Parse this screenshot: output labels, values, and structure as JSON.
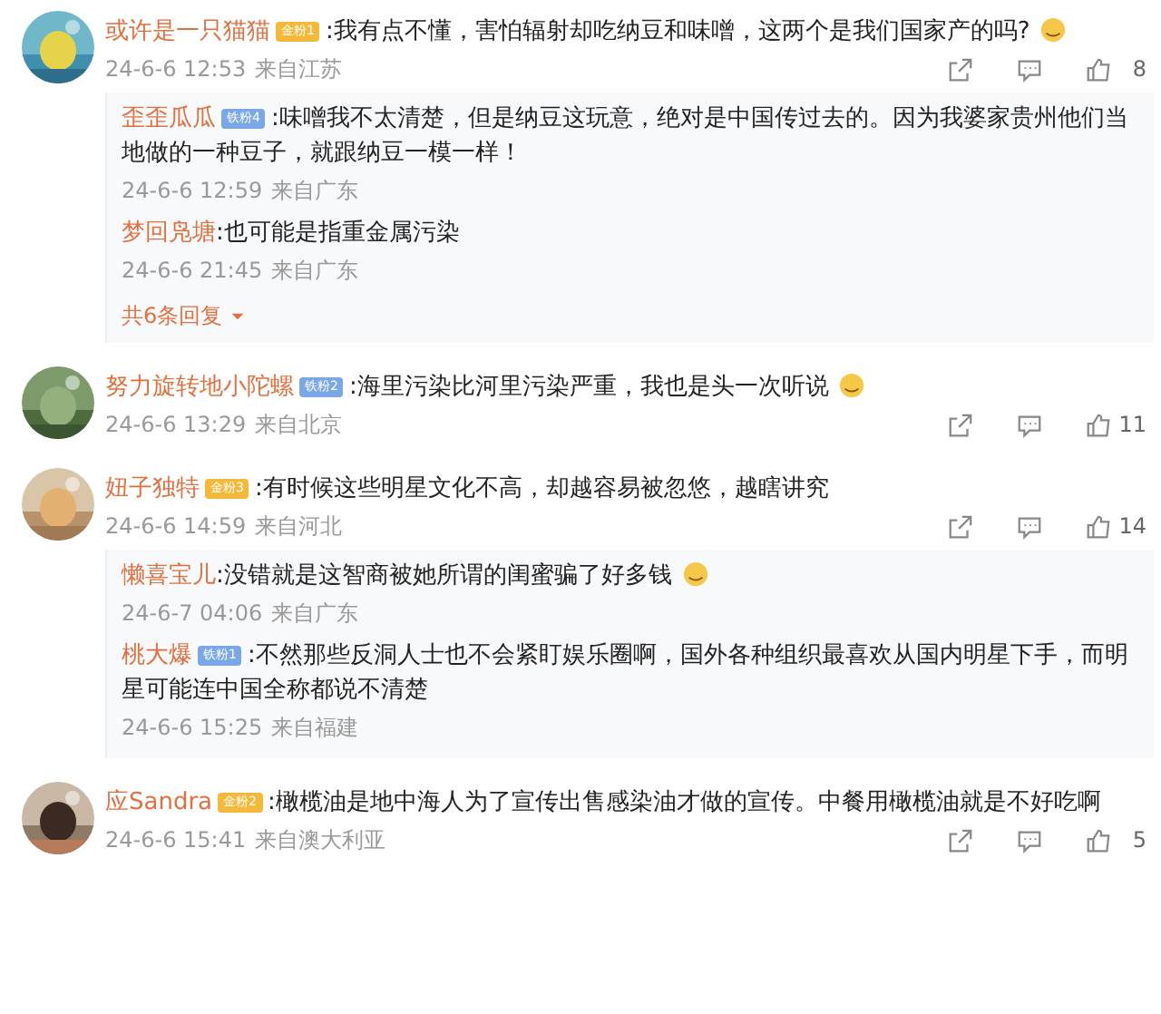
{
  "comments": [
    {
      "name": "或许是一只猫猫",
      "badge": {
        "kind": "gold",
        "label": "金粉1"
      },
      "text": ":我有点不懂，害怕辐射却吃纳豆和味噌，这两个是我们国家产的吗?",
      "emoji": true,
      "time": "24-6-6 12:53",
      "location": "来自江苏",
      "likes": "8",
      "replies": [
        {
          "name": "歪歪瓜瓜",
          "badge": {
            "kind": "iron",
            "label": "铁粉4"
          },
          "text": ":味噌我不太清楚，但是纳豆这玩意，绝对是中国传过去的。因为我婆家贵州他们当地做的一种豆子，就跟纳豆一模一样！",
          "time": "24-6-6 12:59",
          "location": "来自广东"
        },
        {
          "name": "梦回凫塘",
          "text": ":也可能是指重金属污染",
          "time": "24-6-6 21:45",
          "location": "来自广东"
        }
      ],
      "more": "共6条回复"
    },
    {
      "name": "努力旋转地小陀螺",
      "badge": {
        "kind": "iron",
        "label": "铁粉2"
      },
      "text": ":海里污染比河里污染严重，我也是头一次听说",
      "emoji": true,
      "time": "24-6-6 13:29",
      "location": "来自北京",
      "likes": "11"
    },
    {
      "name": "妞子独特",
      "badge": {
        "kind": "gold",
        "label": "金粉3"
      },
      "text": ":有时候这些明星文化不高，却越容易被忽悠，越瞎讲究",
      "time": "24-6-6 14:59",
      "location": "来自河北",
      "likes": "14",
      "replies": [
        {
          "name": "懒喜宝儿",
          "text": ":没错就是这智商被她所谓的闺蜜骗了好多钱",
          "emoji": true,
          "time": "24-6-7 04:06",
          "location": "来自广东"
        },
        {
          "name": "桃大爆",
          "badge": {
            "kind": "iron",
            "label": "铁粉1"
          },
          "text": ":不然那些反洞人士也不会紧盯娱乐圈啊，国外各种组织最喜欢从国内明星下手，而明星可能连中国全称都说不清楚",
          "time": "24-6-6 15:25",
          "location": "来自福建"
        }
      ]
    },
    {
      "name": "应Sandra",
      "badge": {
        "kind": "gold",
        "label": "金粉2"
      },
      "text": ":橄榄油是地中海人为了宣传出售感染油才做的宣传。中餐用橄榄油就是不好吃啊",
      "time": "24-6-6 15:41",
      "location": "来自澳大利亚",
      "likes": "5"
    }
  ]
}
